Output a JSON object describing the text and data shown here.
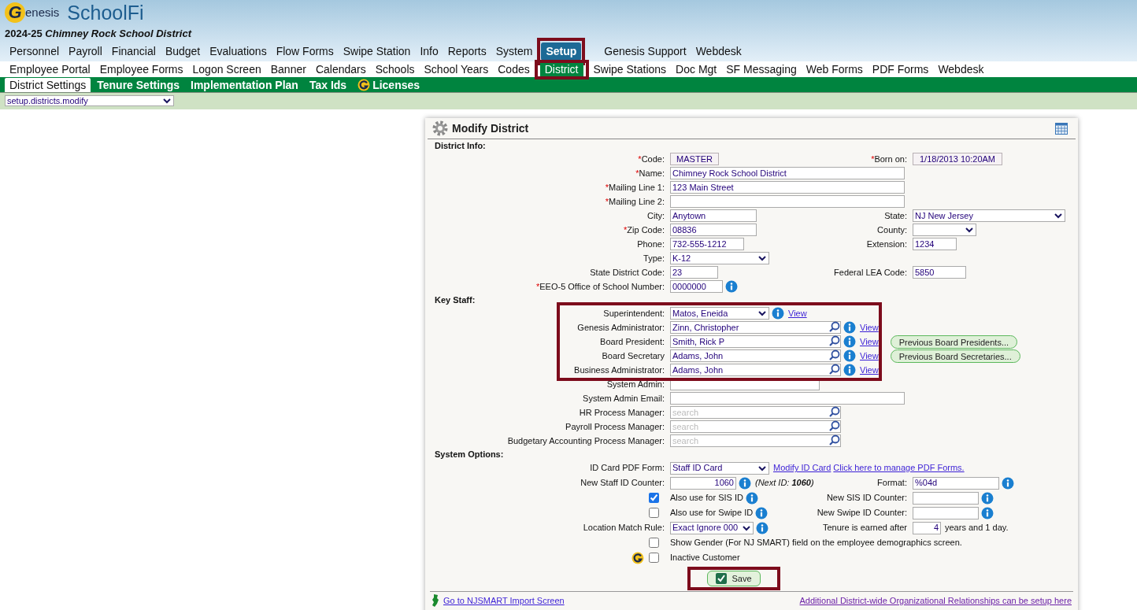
{
  "header": {
    "logo_mark": "G",
    "logo_word": "enesis",
    "product": "SchoolFi",
    "year": "2024-25",
    "district": "Chimney Rock School District"
  },
  "top_nav": {
    "modules": [
      {
        "label": "Personnel",
        "selected": false,
        "highlighted": false
      },
      {
        "label": "Payroll",
        "selected": false,
        "highlighted": false
      },
      {
        "label": "Financial",
        "selected": false,
        "highlighted": false
      },
      {
        "label": "Budget",
        "selected": false,
        "highlighted": false
      },
      {
        "label": "Evaluations",
        "selected": false,
        "highlighted": false
      },
      {
        "label": "Flow Forms",
        "selected": false,
        "highlighted": false
      },
      {
        "label": "Swipe Station",
        "selected": false,
        "highlighted": false
      },
      {
        "label": "Info",
        "selected": false,
        "highlighted": false
      },
      {
        "label": "Reports",
        "selected": false,
        "highlighted": false
      },
      {
        "label": "System",
        "selected": false,
        "highlighted": false
      },
      {
        "label": "Setup",
        "selected": true,
        "highlighted": true
      }
    ],
    "links": [
      "Genesis Support",
      "Webdesk"
    ]
  },
  "sub_nav": [
    {
      "label": "Employee Portal",
      "selected": false,
      "highlighted": false
    },
    {
      "label": "Employee Forms",
      "selected": false,
      "highlighted": false
    },
    {
      "label": "Logon Screen",
      "selected": false,
      "highlighted": false
    },
    {
      "label": "Banner",
      "selected": false,
      "highlighted": false
    },
    {
      "label": "Calendars",
      "selected": false,
      "highlighted": false
    },
    {
      "label": "Schools",
      "selected": false,
      "highlighted": false
    },
    {
      "label": "School Years",
      "selected": false,
      "highlighted": false
    },
    {
      "label": "Codes",
      "selected": false,
      "highlighted": false
    },
    {
      "label": "District",
      "selected": true,
      "highlighted": true
    },
    {
      "label": "Swipe Stations",
      "selected": false,
      "highlighted": false
    },
    {
      "label": "Doc Mgt",
      "selected": false,
      "highlighted": false
    },
    {
      "label": "SF Messaging",
      "selected": false,
      "highlighted": false
    },
    {
      "label": "Web Forms",
      "selected": false,
      "highlighted": false
    },
    {
      "label": "PDF Forms",
      "selected": false,
      "highlighted": false
    },
    {
      "label": "Webdesk",
      "selected": false,
      "highlighted": false
    }
  ],
  "tabs": [
    {
      "label": "District Settings",
      "selected": true,
      "kind": "plain"
    },
    {
      "label": "Tenure Settings",
      "selected": false,
      "kind": "plain"
    },
    {
      "label": "Implementation Plan",
      "selected": false,
      "kind": "plain"
    },
    {
      "label": "Tax Ids",
      "selected": false,
      "kind": "plain"
    },
    {
      "label": "Licenses",
      "selected": false,
      "kind": "logo"
    }
  ],
  "page_select": {
    "value": "setup.districts.modify"
  },
  "panel": {
    "title": "Modify District",
    "sections": [
      {
        "heading": "District Info:",
        "rows": [
          {
            "left": {
              "label": "Code:",
              "marker": "*",
              "kind": "readonly",
              "value": "MASTER"
            },
            "right": {
              "label": "Born on:",
              "marker": "*",
              "kind": "readonly",
              "value": "1/18/2013 10:20AM"
            }
          },
          {
            "left": {
              "label": "Name:",
              "marker": "*",
              "kind": "text",
              "value": "Chimney Rock School District"
            }
          },
          {
            "left": {
              "label": "Mailing Line 1:",
              "marker": "*",
              "kind": "text",
              "value": "123 Main Street"
            }
          },
          {
            "left": {
              "label": "Mailing Line 2:",
              "marker": "*",
              "kind": "text"
            }
          },
          {
            "left": {
              "label": "City:",
              "kind": "text",
              "value": "Anytown"
            },
            "right": {
              "label": "State:",
              "kind": "select",
              "value": "NJ New Jersey"
            }
          },
          {
            "left": {
              "label": "Zip Code:",
              "marker": "*",
              "kind": "text",
              "value": "08836"
            },
            "right": {
              "label": "County:",
              "kind": "select"
            }
          },
          {
            "left": {
              "label": "Phone:",
              "kind": "text",
              "value": "732-555-1212"
            },
            "right": {
              "label": "Extension:",
              "kind": "text",
              "value": "1234"
            }
          },
          {
            "left": {
              "label": "Type:",
              "kind": "select",
              "value": "K-12"
            }
          },
          {
            "left": {
              "label": "State District Code:",
              "kind": "text",
              "value": "23"
            },
            "right": {
              "label": "Federal LEA Code:",
              "kind": "text",
              "value": "5850"
            }
          },
          {
            "left": {
              "label": "EEO-5 Office of School Number:",
              "marker": "*",
              "kind": "text",
              "value": "0000000",
              "info": true
            }
          }
        ]
      },
      {
        "heading": "Key Staff:",
        "rows": [
          {
            "highlighted": true,
            "left": {
              "label": "Superintendent:",
              "kind": "select",
              "value": "Matos, Eneida",
              "info": true,
              "links": [
                "View"
              ]
            }
          },
          {
            "highlighted": true,
            "left": {
              "label": "Genesis Administrator:",
              "kind": "lookup",
              "value": "Zinn, Christopher",
              "info": true,
              "links": [
                "View"
              ]
            }
          },
          {
            "highlighted": true,
            "left": {
              "label": "Board President:",
              "kind": "lookup",
              "value": "Smith, Rick P",
              "info": true,
              "links": [
                "View"
              ],
              "button": "Previous Board Presidents..."
            }
          },
          {
            "highlighted": true,
            "left": {
              "label": "Board Secretary",
              "kind": "lookup",
              "value": "Adams, John",
              "info": true,
              "links": [
                "View"
              ],
              "button": "Previous Board Secretaries..."
            }
          },
          {
            "highlighted": true,
            "left": {
              "label": "Business Administrator:",
              "kind": "lookup",
              "value": "Adams, John",
              "info": true,
              "links": [
                "View"
              ]
            }
          },
          {
            "highlighted": false,
            "left": {
              "label": "System Admin:",
              "kind": "text"
            }
          },
          {
            "highlighted": false,
            "left": {
              "label": "System Admin Email:",
              "kind": "text"
            }
          },
          {
            "highlighted": false,
            "left": {
              "label": "HR Process Manager:",
              "kind": "lookup",
              "placeholder": "search"
            }
          },
          {
            "highlighted": false,
            "left": {
              "label": "Payroll Process Manager:",
              "kind": "lookup",
              "placeholder": "search"
            }
          },
          {
            "highlighted": false,
            "left": {
              "label": "Budgetary Accounting Process Manager:",
              "kind": "lookup",
              "placeholder": "search"
            }
          }
        ]
      },
      {
        "heading": "System Options:",
        "rows": [
          {
            "left": {
              "label": "ID Card PDF Form:",
              "kind": "select",
              "value": "Staff ID Card",
              "links": [
                "Modify ID Card",
                "Click here to manage PDF Forms."
              ]
            }
          },
          {
            "left": {
              "label": "New Staff ID Counter:",
              "kind": "number",
              "value": "1060",
              "info": true,
              "note": "(Next ID: **1060**)"
            },
            "right": {
              "label": "Format:",
              "kind": "text",
              "value": "%04d",
              "info": true
            }
          },
          {
            "left": {
              "kind": "checkbox",
              "checked": true,
              "text": "Also use for SIS ID",
              "info": true
            },
            "right": {
              "label": "New SIS ID Counter:",
              "kind": "text",
              "info": true
            }
          },
          {
            "left": {
              "kind": "checkbox",
              "checked": false,
              "text": "Also use for Swipe ID",
              "info": true
            },
            "right": {
              "label": "New Swipe ID Counter:",
              "kind": "text",
              "info": true
            }
          },
          {
            "left": {
              "label": "Location Match Rule:",
              "kind": "select",
              "value": "Exact Ignore 000",
              "info": true
            },
            "right": {
              "label": "Tenure is earned after",
              "kind": "number",
              "value": "4",
              "suffix": "years and 1 day."
            }
          },
          {
            "left": {
              "kind": "checkbox",
              "checked": false,
              "text": "Show Gender (For NJ SMART) field on the employee demographics screen."
            }
          },
          {
            "left": {
              "kind": "checkbox",
              "checked": false,
              "text": "Inactive Customer",
              "logo": true
            }
          }
        ]
      }
    ],
    "save": {
      "label": "Save",
      "highlighted": true
    },
    "footer_links": [
      {
        "label": "Go to NJSMART Import Screen",
        "kind": "state"
      },
      {
        "label": "Additional District-wide Organizational Relationships can be setup here",
        "kind": "plain"
      }
    ]
  }
}
